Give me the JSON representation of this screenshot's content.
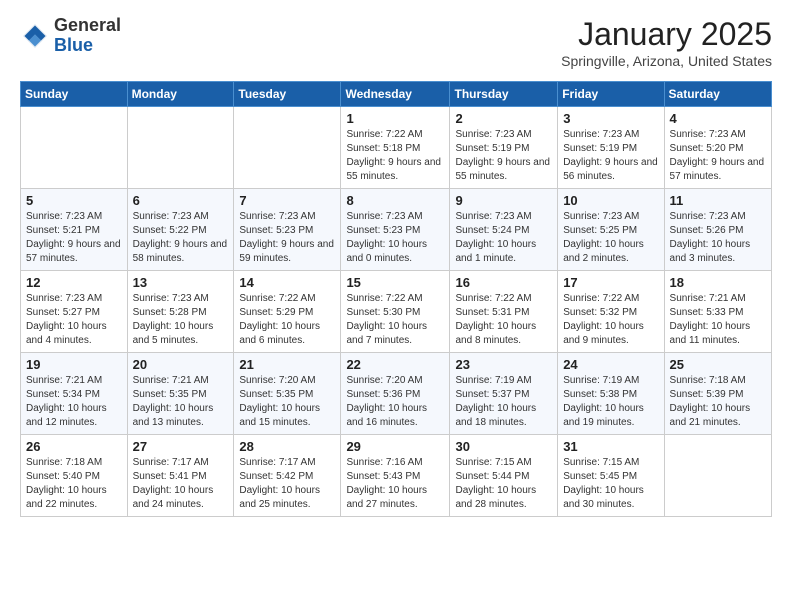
{
  "header": {
    "logo_general": "General",
    "logo_blue": "Blue",
    "month": "January 2025",
    "location": "Springville, Arizona, United States"
  },
  "days_of_week": [
    "Sunday",
    "Monday",
    "Tuesday",
    "Wednesday",
    "Thursday",
    "Friday",
    "Saturday"
  ],
  "weeks": [
    [
      {
        "day": null
      },
      {
        "day": null
      },
      {
        "day": null
      },
      {
        "day": "1",
        "sunrise": "Sunrise: 7:22 AM",
        "sunset": "Sunset: 5:18 PM",
        "daylight": "Daylight: 9 hours and 55 minutes."
      },
      {
        "day": "2",
        "sunrise": "Sunrise: 7:23 AM",
        "sunset": "Sunset: 5:19 PM",
        "daylight": "Daylight: 9 hours and 55 minutes."
      },
      {
        "day": "3",
        "sunrise": "Sunrise: 7:23 AM",
        "sunset": "Sunset: 5:19 PM",
        "daylight": "Daylight: 9 hours and 56 minutes."
      },
      {
        "day": "4",
        "sunrise": "Sunrise: 7:23 AM",
        "sunset": "Sunset: 5:20 PM",
        "daylight": "Daylight: 9 hours and 57 minutes."
      }
    ],
    [
      {
        "day": "5",
        "sunrise": "Sunrise: 7:23 AM",
        "sunset": "Sunset: 5:21 PM",
        "daylight": "Daylight: 9 hours and 57 minutes."
      },
      {
        "day": "6",
        "sunrise": "Sunrise: 7:23 AM",
        "sunset": "Sunset: 5:22 PM",
        "daylight": "Daylight: 9 hours and 58 minutes."
      },
      {
        "day": "7",
        "sunrise": "Sunrise: 7:23 AM",
        "sunset": "Sunset: 5:23 PM",
        "daylight": "Daylight: 9 hours and 59 minutes."
      },
      {
        "day": "8",
        "sunrise": "Sunrise: 7:23 AM",
        "sunset": "Sunset: 5:23 PM",
        "daylight": "Daylight: 10 hours and 0 minutes."
      },
      {
        "day": "9",
        "sunrise": "Sunrise: 7:23 AM",
        "sunset": "Sunset: 5:24 PM",
        "daylight": "Daylight: 10 hours and 1 minute."
      },
      {
        "day": "10",
        "sunrise": "Sunrise: 7:23 AM",
        "sunset": "Sunset: 5:25 PM",
        "daylight": "Daylight: 10 hours and 2 minutes."
      },
      {
        "day": "11",
        "sunrise": "Sunrise: 7:23 AM",
        "sunset": "Sunset: 5:26 PM",
        "daylight": "Daylight: 10 hours and 3 minutes."
      }
    ],
    [
      {
        "day": "12",
        "sunrise": "Sunrise: 7:23 AM",
        "sunset": "Sunset: 5:27 PM",
        "daylight": "Daylight: 10 hours and 4 minutes."
      },
      {
        "day": "13",
        "sunrise": "Sunrise: 7:23 AM",
        "sunset": "Sunset: 5:28 PM",
        "daylight": "Daylight: 10 hours and 5 minutes."
      },
      {
        "day": "14",
        "sunrise": "Sunrise: 7:22 AM",
        "sunset": "Sunset: 5:29 PM",
        "daylight": "Daylight: 10 hours and 6 minutes."
      },
      {
        "day": "15",
        "sunrise": "Sunrise: 7:22 AM",
        "sunset": "Sunset: 5:30 PM",
        "daylight": "Daylight: 10 hours and 7 minutes."
      },
      {
        "day": "16",
        "sunrise": "Sunrise: 7:22 AM",
        "sunset": "Sunset: 5:31 PM",
        "daylight": "Daylight: 10 hours and 8 minutes."
      },
      {
        "day": "17",
        "sunrise": "Sunrise: 7:22 AM",
        "sunset": "Sunset: 5:32 PM",
        "daylight": "Daylight: 10 hours and 9 minutes."
      },
      {
        "day": "18",
        "sunrise": "Sunrise: 7:21 AM",
        "sunset": "Sunset: 5:33 PM",
        "daylight": "Daylight: 10 hours and 11 minutes."
      }
    ],
    [
      {
        "day": "19",
        "sunrise": "Sunrise: 7:21 AM",
        "sunset": "Sunset: 5:34 PM",
        "daylight": "Daylight: 10 hours and 12 minutes."
      },
      {
        "day": "20",
        "sunrise": "Sunrise: 7:21 AM",
        "sunset": "Sunset: 5:35 PM",
        "daylight": "Daylight: 10 hours and 13 minutes."
      },
      {
        "day": "21",
        "sunrise": "Sunrise: 7:20 AM",
        "sunset": "Sunset: 5:35 PM",
        "daylight": "Daylight: 10 hours and 15 minutes."
      },
      {
        "day": "22",
        "sunrise": "Sunrise: 7:20 AM",
        "sunset": "Sunset: 5:36 PM",
        "daylight": "Daylight: 10 hours and 16 minutes."
      },
      {
        "day": "23",
        "sunrise": "Sunrise: 7:19 AM",
        "sunset": "Sunset: 5:37 PM",
        "daylight": "Daylight: 10 hours and 18 minutes."
      },
      {
        "day": "24",
        "sunrise": "Sunrise: 7:19 AM",
        "sunset": "Sunset: 5:38 PM",
        "daylight": "Daylight: 10 hours and 19 minutes."
      },
      {
        "day": "25",
        "sunrise": "Sunrise: 7:18 AM",
        "sunset": "Sunset: 5:39 PM",
        "daylight": "Daylight: 10 hours and 21 minutes."
      }
    ],
    [
      {
        "day": "26",
        "sunrise": "Sunrise: 7:18 AM",
        "sunset": "Sunset: 5:40 PM",
        "daylight": "Daylight: 10 hours and 22 minutes."
      },
      {
        "day": "27",
        "sunrise": "Sunrise: 7:17 AM",
        "sunset": "Sunset: 5:41 PM",
        "daylight": "Daylight: 10 hours and 24 minutes."
      },
      {
        "day": "28",
        "sunrise": "Sunrise: 7:17 AM",
        "sunset": "Sunset: 5:42 PM",
        "daylight": "Daylight: 10 hours and 25 minutes."
      },
      {
        "day": "29",
        "sunrise": "Sunrise: 7:16 AM",
        "sunset": "Sunset: 5:43 PM",
        "daylight": "Daylight: 10 hours and 27 minutes."
      },
      {
        "day": "30",
        "sunrise": "Sunrise: 7:15 AM",
        "sunset": "Sunset: 5:44 PM",
        "daylight": "Daylight: 10 hours and 28 minutes."
      },
      {
        "day": "31",
        "sunrise": "Sunrise: 7:15 AM",
        "sunset": "Sunset: 5:45 PM",
        "daylight": "Daylight: 10 hours and 30 minutes."
      },
      {
        "day": null
      }
    ]
  ]
}
